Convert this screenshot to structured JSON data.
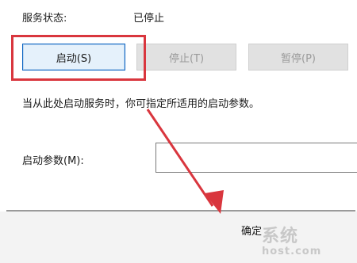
{
  "service_status": {
    "label": "服务状态:",
    "value": "已停止"
  },
  "buttons": {
    "start": "启动(S)",
    "stop": "停止(T)",
    "pause": "暂停(P)"
  },
  "hint": "当从此处启动服务时，你可指定所适用的启动参数。",
  "start_params": {
    "label": "启动参数(M):",
    "value": ""
  },
  "dialog": {
    "ok_label": "确定"
  },
  "watermark": {
    "text": "系统",
    "url": "host.com"
  },
  "colors": {
    "highlight": "#d9363e",
    "arrow": "#d9363e"
  }
}
